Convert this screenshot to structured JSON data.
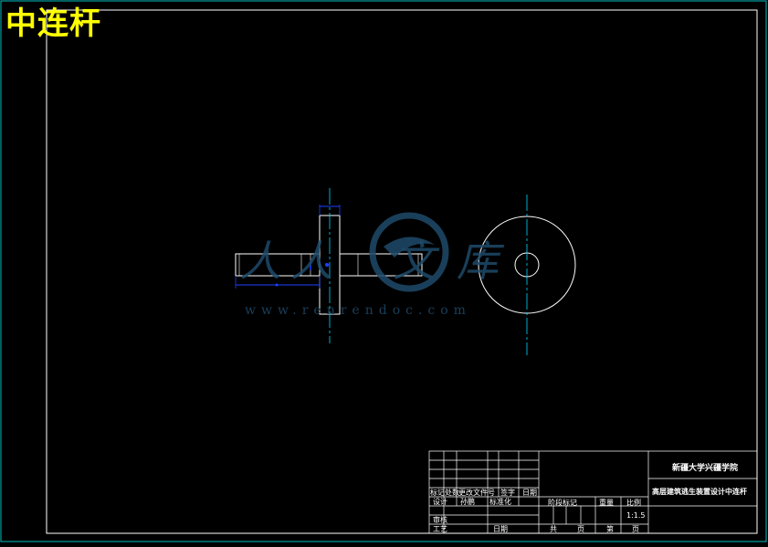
{
  "drawing": {
    "title": "中连杆"
  },
  "title_block": {
    "organization": "新疆大学兴疆学院",
    "drawing_name": "高层建筑逃生装置设计中连杆",
    "row_labels": [
      "标记",
      "处数",
      "更改文件号",
      "签字",
      "日期"
    ],
    "designer_row": [
      "设计",
      "孙鹏",
      "标准化"
    ],
    "review_label": "审核",
    "process_label": "工艺",
    "approve_label": "日期",
    "stage_label": "阶段标记",
    "weight_label": "重量",
    "scale_label": "比例",
    "scale_value": "1:1.5",
    "sheets_total_label": "共",
    "sheets_unit_a": "页",
    "sheet_no_label": "第",
    "sheets_unit_b": "页"
  },
  "watermark": {
    "chars": [
      "人",
      "人",
      "文",
      "库"
    ],
    "url": "www.renrendoc.com"
  },
  "colors": {
    "background": "#000000",
    "frame": "#ffffff",
    "border_outer": "#00c0c0",
    "centerline": "#00d8ff",
    "dimension": "#2040ff",
    "title_text": "#ffff00",
    "watermark": "#1e4a6a"
  }
}
